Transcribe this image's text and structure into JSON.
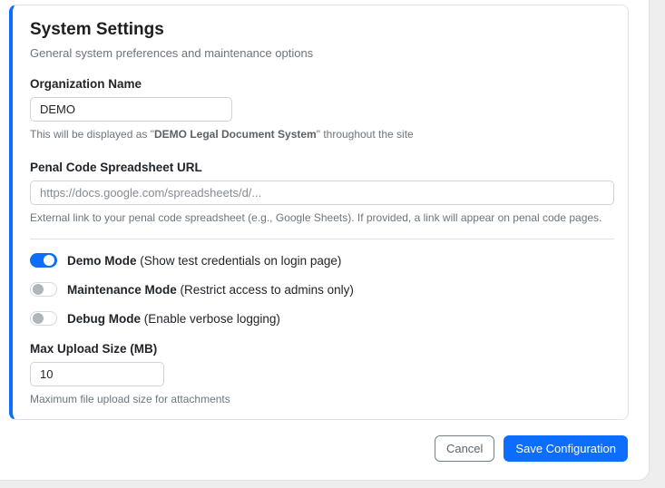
{
  "page": {
    "title": "System Settings",
    "subtitle": "General system preferences and maintenance options"
  },
  "fields": {
    "organization_name": {
      "label": "Organization Name",
      "value": "DEMO",
      "help_prefix": "This will be displayed as \"",
      "help_bold": "DEMO Legal Document System",
      "help_suffix": "\" throughout the site"
    },
    "penal_code_url": {
      "label": "Penal Code Spreadsheet URL",
      "placeholder": "https://docs.google.com/spreadsheets/d/...",
      "help": "External link to your penal code spreadsheet (e.g., Google Sheets). If provided, a link will appear on penal code pages."
    },
    "max_upload_size": {
      "label": "Max Upload Size (MB)",
      "value": "10",
      "help": "Maximum file upload size for attachments"
    }
  },
  "toggles": [
    {
      "name": "Demo Mode",
      "description": "(Show test credentials on login page)",
      "state": "on"
    },
    {
      "name": "Maintenance Mode",
      "description": "(Restrict access to admins only)",
      "state": "off"
    },
    {
      "name": "Debug Mode",
      "description": "(Enable verbose logging)",
      "state": "off"
    }
  ],
  "footer": {
    "cancel_label": "Cancel",
    "save_label": "Save Configuration"
  },
  "colors": {
    "accent_blue": "#0d6efd",
    "helper_gray": "#6c757d",
    "card_border": "#dee2e6"
  }
}
